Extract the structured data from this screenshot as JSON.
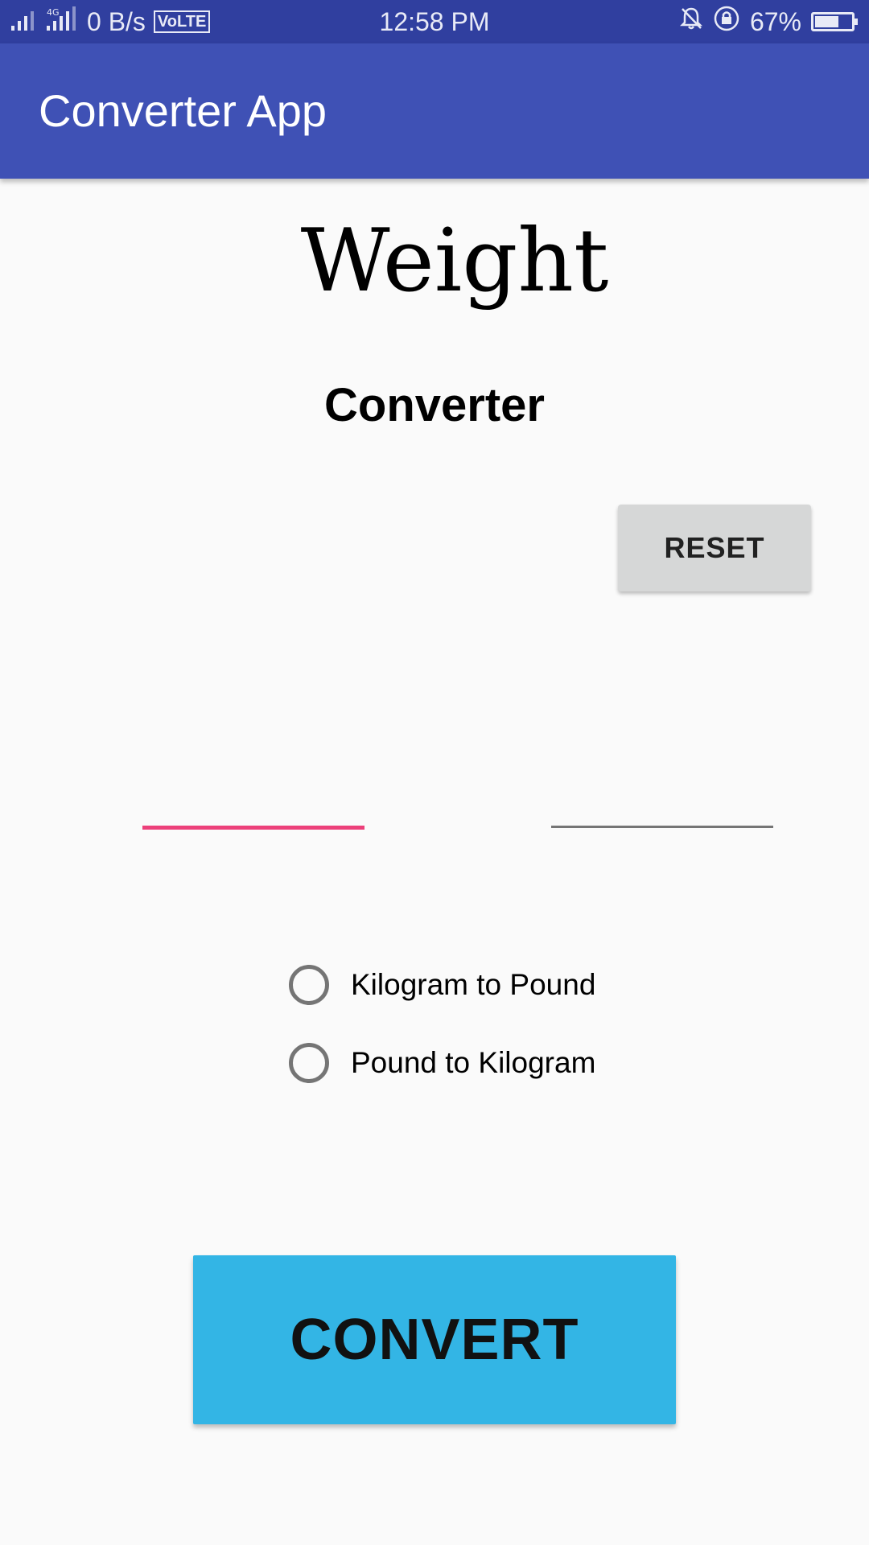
{
  "status_bar": {
    "network_speed": "0 B/s",
    "network_type": "4G",
    "volte": "VoLTE",
    "time": "12:58 PM",
    "battery_percent": "67%",
    "battery_level": 0.67,
    "icons": [
      "signal-icon",
      "signal-4g-icon",
      "notification-muted-icon",
      "rotation-lock-icon",
      "battery-icon"
    ]
  },
  "app_bar": {
    "title": "Converter App",
    "color": "#3f51b5"
  },
  "main": {
    "title": "Weight",
    "subtitle": "Converter",
    "reset_label": "RESET",
    "input_left": {
      "value": "",
      "placeholder": ""
    },
    "input_right": {
      "value": "",
      "placeholder": ""
    },
    "options": [
      {
        "label": "Kilogram to Pound",
        "selected": false
      },
      {
        "label": "Pound to Kilogram",
        "selected": false
      }
    ],
    "convert_label": "CONVERT"
  },
  "colors": {
    "status_bar": "#303f9f",
    "accent": "#ec407a",
    "convert_button": "#33b5e5",
    "reset_button": "#d6d7d7",
    "background": "#fafafa"
  }
}
